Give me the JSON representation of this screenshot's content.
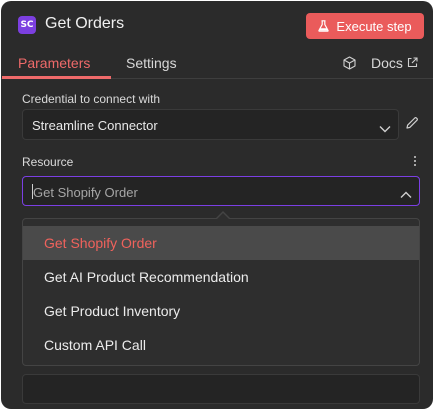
{
  "header": {
    "logo_text": "SC",
    "title": "Get Orders",
    "execute_label": "Execute step",
    "execute_icon": "flask-icon"
  },
  "tabs": [
    {
      "label": "Parameters",
      "active": true
    },
    {
      "label": "Settings",
      "active": false
    }
  ],
  "docs": {
    "label": "Docs",
    "icon": "external-link-icon",
    "node_icon": "box-icon"
  },
  "credential": {
    "label": "Credential to connect with",
    "value": "Streamline Connector"
  },
  "resource": {
    "label": "Resource",
    "value": "Get Shopify Order",
    "options": [
      {
        "label": "Get Shopify Order",
        "selected": true
      },
      {
        "label": "Get AI Product Recommendation",
        "selected": false
      },
      {
        "label": "Get Product Inventory",
        "selected": false
      },
      {
        "label": "Custom API Call",
        "selected": false
      }
    ]
  },
  "colors": {
    "accent": "#ef6a6a",
    "button": "#ea5b5b",
    "focus_border": "#7b3fe4",
    "logo": "#7c3fe0",
    "panel": "#2b2b2b"
  }
}
